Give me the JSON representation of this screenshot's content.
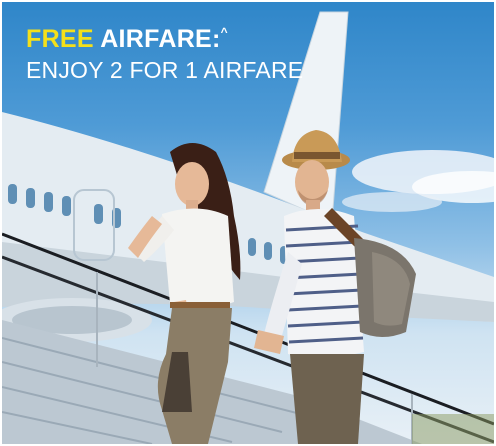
{
  "promo": {
    "free_word": "FREE",
    "title_word": " AIRFARE:",
    "caret_mark": "^",
    "subtitle": "ENJOY 2 FOR 1 AIRFARE"
  },
  "image": {
    "subject": "couple boarding airplane via stairs",
    "colors": {
      "highlight_yellow": "#f4e01a",
      "sky_blue": "#3d8fcf",
      "fuselage_white": "#e6eef4"
    }
  }
}
